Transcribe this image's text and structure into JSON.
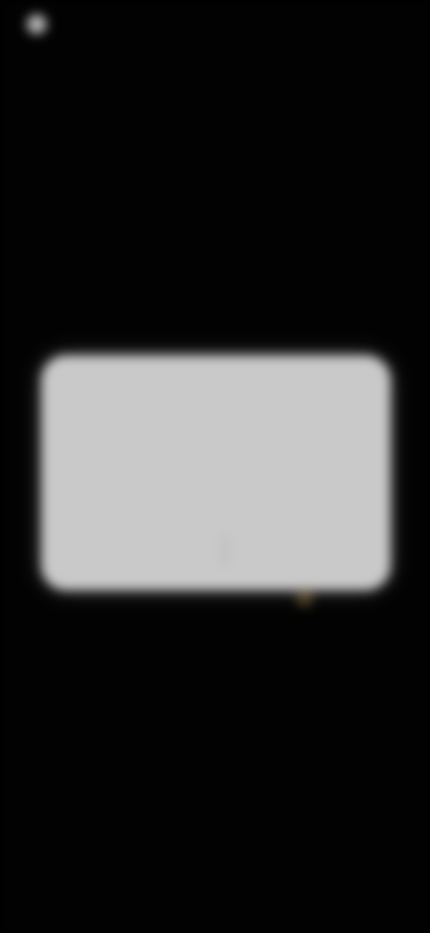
{
  "status_bar": {
    "left_text": "",
    "right_text": ""
  },
  "dialog": {
    "title": "",
    "message": "",
    "negative_button": "",
    "positive_button": ""
  }
}
